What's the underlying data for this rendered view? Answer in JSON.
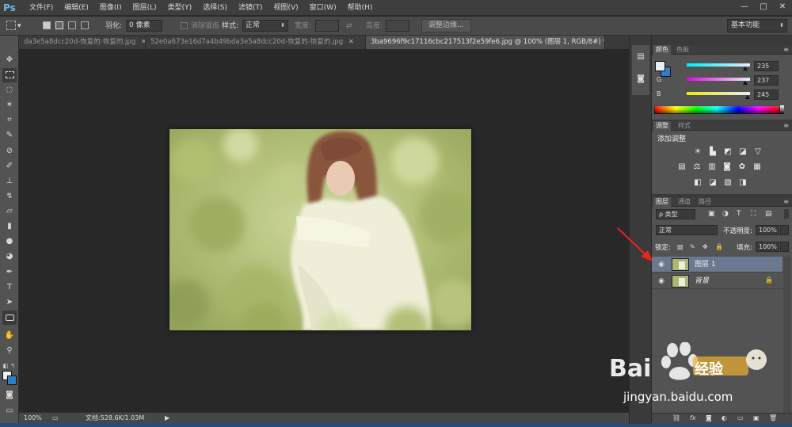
{
  "app": {
    "logo": "Ps",
    "menu": [
      "文件(F)",
      "编辑(E)",
      "图像(I)",
      "图层(L)",
      "类型(Y)",
      "选择(S)",
      "滤镜(T)",
      "视图(V)",
      "窗口(W)",
      "帮助(H)"
    ],
    "window_controls": [
      "—",
      "□",
      "✕"
    ]
  },
  "options": {
    "feather_label": "羽化:",
    "feather_value": "0 像素",
    "antialias_label": "消除锯齿",
    "style_label": "样式:",
    "style_value": "正常",
    "width_label": "宽度:",
    "height_label": "高度:",
    "refine_edge_label": "调整边缘...",
    "workspace": "基本功能"
  },
  "tabs": [
    {
      "label": "da3e5a8dcc20d-恢复的-恢复的.jpg",
      "close": "✕"
    },
    {
      "label": "52e0a673e16d7a4b49bda3e5a8dcc20d-恢复的-恢复的.jpg",
      "close": "✕"
    },
    {
      "label": "3ba9696f9c17116cbc217513f2e59fe6.jpg @ 100% (图层 1, RGB/8#) *",
      "close": "✕"
    }
  ],
  "status": {
    "zoom": "100%",
    "doc_info": "文档:528.6K/1.03M"
  },
  "color_panel": {
    "tabs": [
      "颜色",
      "色板"
    ],
    "channels": [
      {
        "label": "R",
        "value": "235",
        "level": 0.92
      },
      {
        "label": "G",
        "value": "237",
        "level": 0.93
      },
      {
        "label": "B",
        "value": "245",
        "level": 0.96
      }
    ],
    "colors": {
      "foreground": "#ebedf5",
      "background": "#2f7ec6"
    }
  },
  "adjust_panel": {
    "tabs": [
      "调整",
      "样式"
    ],
    "title": "添加调整",
    "row1": [
      "☀",
      "▙",
      "◩",
      "◪",
      "▽"
    ],
    "row2": [
      "▤",
      "⚖",
      "▥",
      "◙",
      "✿",
      "▦"
    ],
    "row3": [
      "◧",
      "◪",
      "▧",
      "◨"
    ]
  },
  "layers_panel": {
    "tabs": [
      "图层",
      "通道",
      "路径"
    ],
    "filter_label": "ρ 类型",
    "filter_icons": [
      "▣",
      "◑",
      "T",
      "⛶",
      "▤"
    ],
    "blend_mode": "正常",
    "opacity_label": "不透明度:",
    "opacity_value": "100%",
    "lock_label": "锁定:",
    "fill_label": "填充:",
    "fill_value": "100%",
    "lock_icons": [
      "▨",
      "✎",
      "✥",
      "🔒"
    ],
    "layers": [
      {
        "name": "图层 1",
        "selected": true
      },
      {
        "name": "背景",
        "selected": false,
        "locked": "🔒"
      }
    ],
    "footer_icons": [
      "⛓",
      "fx",
      "◙",
      "◐",
      "▭",
      "▣",
      "🗑"
    ]
  },
  "watermark": {
    "brand": "Bai",
    "brand2": "经验",
    "url": "jingyan.baidu.com"
  }
}
